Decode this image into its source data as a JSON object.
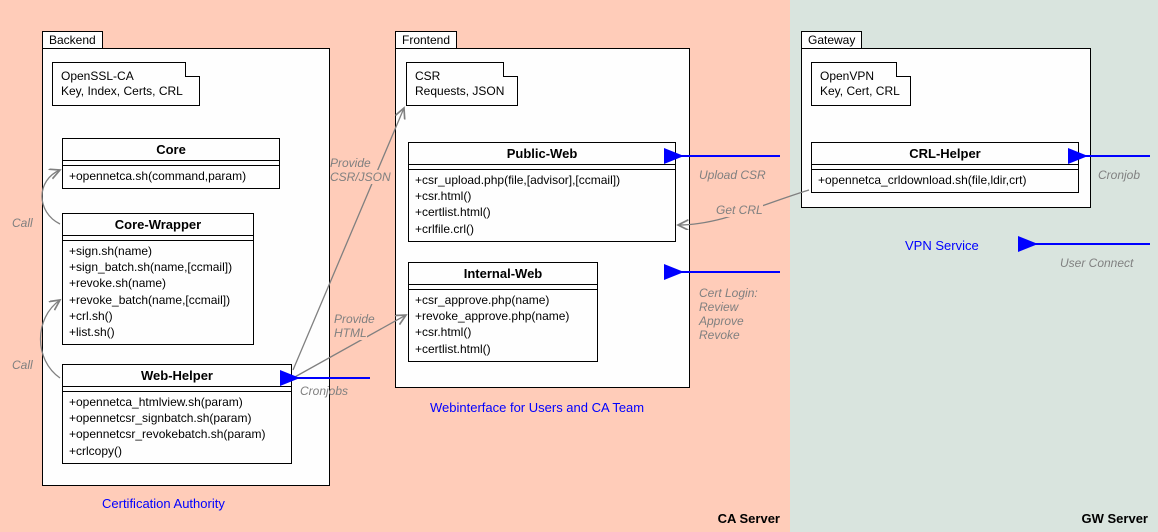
{
  "regions": {
    "ca": "CA Server",
    "gw": "GW Server"
  },
  "packages": {
    "backend": "Backend",
    "frontend": "Frontend",
    "gateway": "Gateway"
  },
  "notes": {
    "openssl": {
      "line1": "OpenSSL-CA",
      "line2": "Key, Index, Certs, CRL"
    },
    "csr": {
      "line1": "CSR",
      "line2": "Requests, JSON"
    },
    "openvpn": {
      "line1": "OpenVPN",
      "line2": "Key, Cert, CRL"
    }
  },
  "classes": {
    "core": {
      "title": "Core",
      "methods": [
        "+opennetca.sh(command,param)"
      ]
    },
    "coreWrapper": {
      "title": "Core-Wrapper",
      "methods": [
        "+sign.sh(name)",
        "+sign_batch.sh(name,[ccmail])",
        "+revoke.sh(name)",
        "+revoke_batch(name,[ccmail])",
        "+crl.sh()",
        "+list.sh()"
      ]
    },
    "webHelper": {
      "title": "Web-Helper",
      "methods": [
        "+opennetca_htmlview.sh(param)",
        "+opennetcsr_signbatch.sh(param)",
        "+opennetcsr_revokebatch.sh(param)",
        "+crlcopy()"
      ]
    },
    "publicWeb": {
      "title": "Public-Web",
      "methods": [
        "+csr_upload.php(file,[advisor],[ccmail])",
        "+csr.html()",
        "+certlist.html()",
        "+crlfile.crl()"
      ]
    },
    "internalWeb": {
      "title": "Internal-Web",
      "methods": [
        "+csr_approve.php(name)",
        "+revoke_approve.php(name)",
        "+csr.html()",
        "+certlist.html()"
      ]
    },
    "crlHelper": {
      "title": "CRL-Helper",
      "methods": [
        "+opennetca_crldownload.sh(file,ldir,crt)"
      ]
    }
  },
  "captions": {
    "backend": "Certification Authority",
    "frontend": "Webinterface for Users and CA Team",
    "gateway": "VPN Service"
  },
  "edgeLabels": {
    "callTop": "Call",
    "callBottom": "Call",
    "provideCsr1": "Provide",
    "provideCsr2": "CSR/JSON",
    "provideHtml1": "Provide",
    "provideHtml2": "HTML",
    "cronjobs": "Cronjobs",
    "uploadCsr": "Upload CSR",
    "certLogin1": "Cert Login:",
    "certLogin2": "Review",
    "certLogin3": "Approve",
    "certLogin4": "Revoke",
    "getCrl": "Get CRL",
    "cronjob": "Cronjob",
    "userConnect": "User Connect"
  }
}
